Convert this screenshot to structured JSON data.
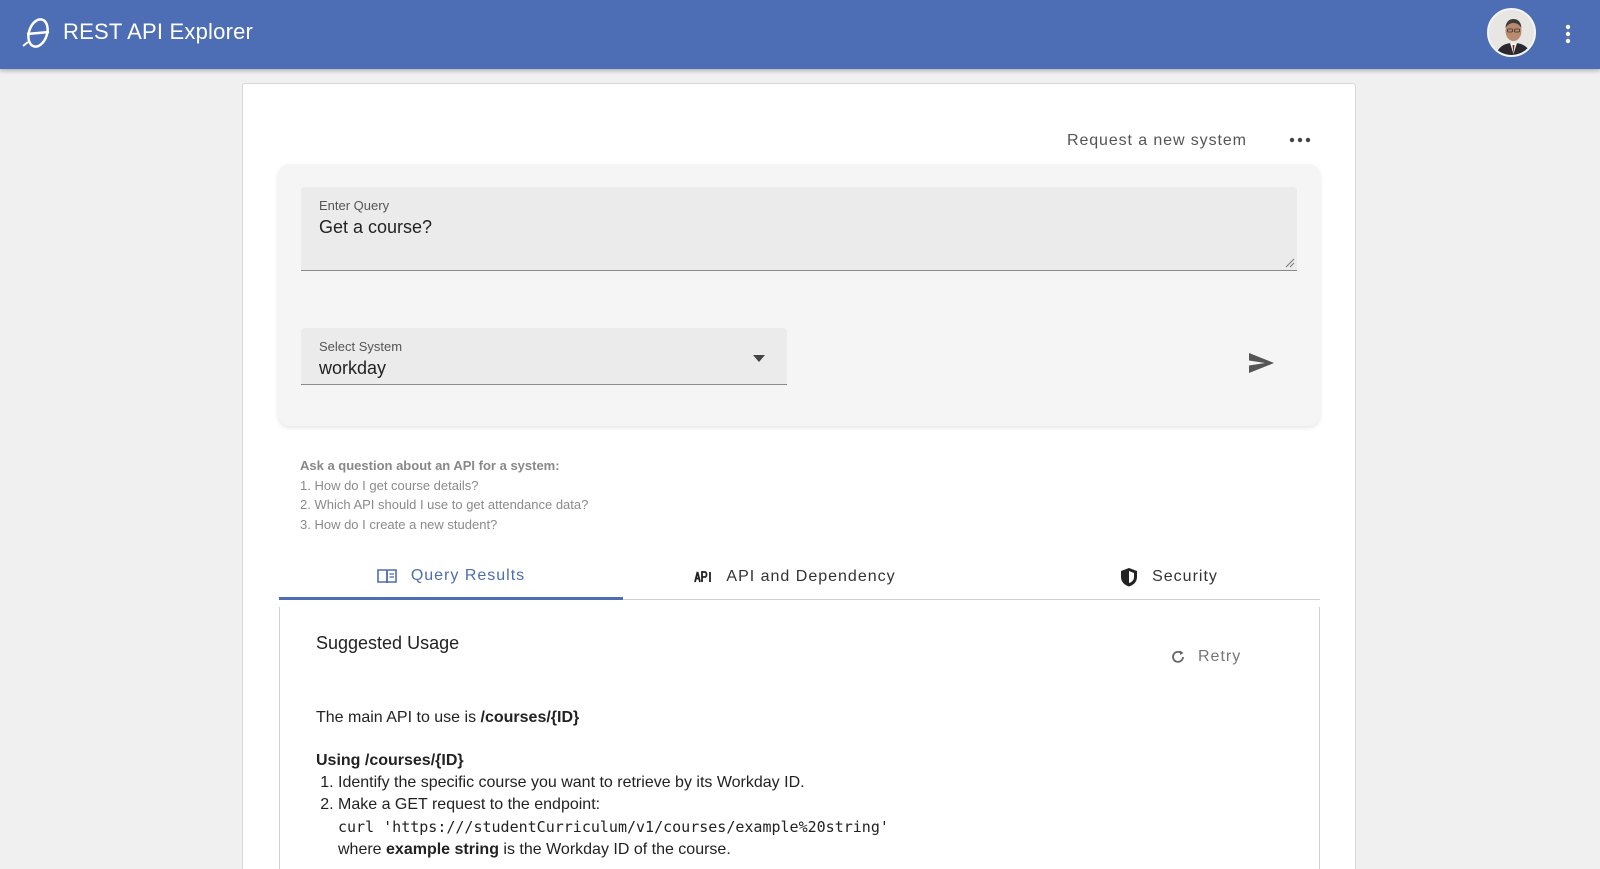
{
  "app": {
    "title": "REST API Explorer",
    "brand_color": "#4d6db5",
    "logo_icon": "theta-logo-icon",
    "avatar_alt": "user avatar"
  },
  "toolbar": {
    "request_link": "Request a new system",
    "more_icon": "more-horizontal-icon"
  },
  "query": {
    "label": "Enter Query",
    "value": "Get a course?"
  },
  "system_select": {
    "label": "Select System",
    "value": "workday"
  },
  "hints": {
    "title": "Ask a question about an API for a system:",
    "items": [
      "1. How do I get course details?",
      "2. Which API should I use to get attendance data?",
      "3. How do I create a new student?"
    ]
  },
  "tabs": [
    {
      "label": "Query Results",
      "icon": "book-icon",
      "active": true
    },
    {
      "label": "API and Dependency",
      "icon": "api-icon",
      "active": false
    },
    {
      "label": "Security",
      "icon": "shield-icon",
      "active": false
    }
  ],
  "results": {
    "title": "Suggested Usage",
    "retry_label": "Retry",
    "intro_prefix": "The main API to use is ",
    "intro_api": "/courses/{ID}",
    "section_heading": "Using /courses/{ID}",
    "steps": [
      "Identify the specific course you want to retrieve by its Workday ID.",
      "Make a GET request to the endpoint:"
    ],
    "curl_command": "curl 'https:///studentCurriculum/v1/courses/example%20string'",
    "where_prefix": "where ",
    "where_term": "example string",
    "where_suffix": " is the Workday ID of the course."
  }
}
